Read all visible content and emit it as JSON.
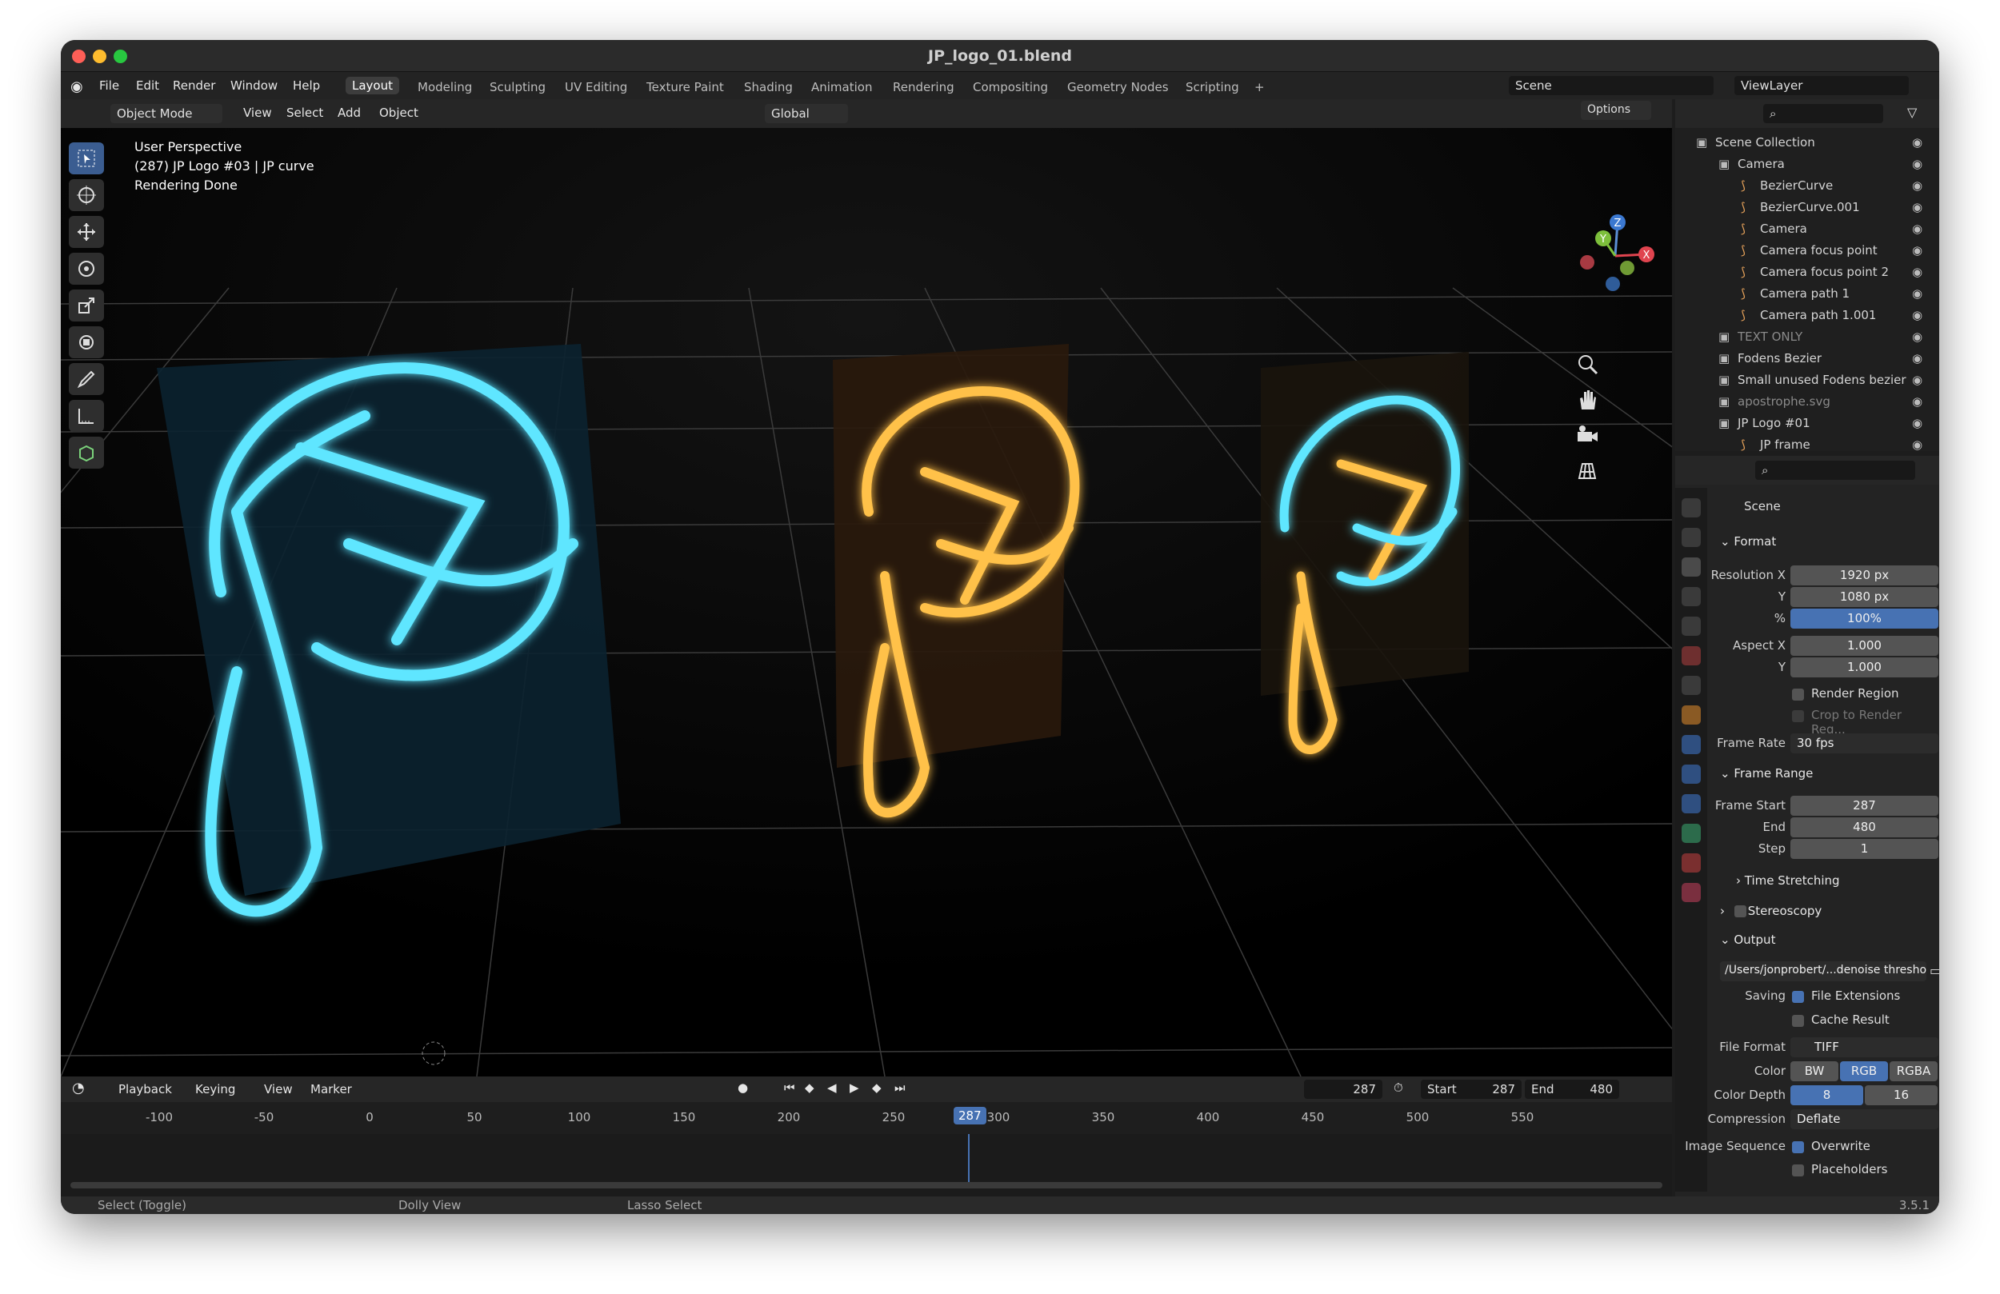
{
  "window": {
    "title": "JP_logo_01.blend"
  },
  "topbar": {
    "menus": [
      "File",
      "Edit",
      "Render",
      "Window",
      "Help"
    ],
    "workspaces": [
      "Layout",
      "Modeling",
      "Sculpting",
      "UV Editing",
      "Texture Paint",
      "Shading",
      "Animation",
      "Rendering",
      "Compositing",
      "Geometry Nodes",
      "Scripting"
    ],
    "add_tab": "+",
    "scene": "Scene",
    "view_layer": "ViewLayer"
  },
  "header3d": {
    "mode": "Object Mode",
    "menus": [
      "View",
      "Select",
      "Add",
      "Object"
    ],
    "orientation": "Global",
    "options": "Options"
  },
  "viewport": {
    "perspective": "User Perspective",
    "object_info": "(287) JP Logo #03 | JP curve",
    "status": "Rendering Done",
    "gizmo": {
      "x": "X",
      "y": "Y",
      "z": "Z"
    }
  },
  "timeline": {
    "menus": [
      "Playback",
      "Keying",
      "View",
      "Marker"
    ],
    "current_frame": "287",
    "start_label": "Start",
    "start": "287",
    "end_label": "End",
    "end": "480",
    "ticks": [
      "-100",
      "-50",
      "0",
      "50",
      "100",
      "150",
      "200",
      "250",
      "300",
      "350",
      "400",
      "450",
      "500",
      "550"
    ],
    "playhead": "287"
  },
  "statusbar": {
    "select": "Select (Toggle)",
    "dolly": "Dolly View",
    "lasso": "Lasso Select",
    "version": "3.5.1"
  },
  "outliner": {
    "rows": [
      {
        "label": "Scene Collection",
        "indent": 0
      },
      {
        "label": "Camera",
        "indent": 1
      },
      {
        "label": "BezierCurve",
        "indent": 2
      },
      {
        "label": "BezierCurve.001",
        "indent": 2
      },
      {
        "label": "Camera",
        "indent": 2
      },
      {
        "label": "Camera focus point",
        "indent": 2
      },
      {
        "label": "Camera focus point 2",
        "indent": 2
      },
      {
        "label": "Camera path 1",
        "indent": 2
      },
      {
        "label": "Camera path 1.001",
        "indent": 2
      },
      {
        "label": "TEXT ONLY",
        "indent": 1
      },
      {
        "label": "Fodens Bezier",
        "indent": 1
      },
      {
        "label": "Small unused Fodens bezier",
        "indent": 1
      },
      {
        "label": "apostrophe.svg",
        "indent": 1
      },
      {
        "label": "JP Logo #01",
        "indent": 1
      },
      {
        "label": "JP frame",
        "indent": 2
      }
    ]
  },
  "properties": {
    "context": "Scene",
    "format": {
      "title": "Format",
      "res_x_label": "Resolution X",
      "res_x": "1920 px",
      "res_y_label": "Y",
      "res_y": "1080 px",
      "pct_label": "%",
      "pct": "100%",
      "aspect_x_label": "Aspect X",
      "aspect_x": "1.000",
      "aspect_y_label": "Y",
      "aspect_y": "1.000",
      "render_region": "Render Region",
      "crop": "Crop to Render Reg...",
      "frame_rate_label": "Frame Rate",
      "frame_rate": "30 fps"
    },
    "frame_range": {
      "title": "Frame Range",
      "start_label": "Frame Start",
      "start": "287",
      "end_label": "End",
      "end": "480",
      "step_label": "Step",
      "step": "1",
      "time_stretching": "Time Stretching"
    },
    "stereoscopy": "Stereoscopy",
    "output": {
      "title": "Output",
      "path": "/Users/jonprobert/...denoise threshold/",
      "saving_label": "Saving",
      "file_extensions": "File Extensions",
      "cache_result": "Cache Result",
      "file_format_label": "File Format",
      "file_format": "TIFF",
      "color_label": "Color",
      "color_opts": [
        "BW",
        "RGB",
        "RGBA"
      ],
      "color_depth_label": "Color Depth",
      "depth_opts": [
        "8",
        "16"
      ],
      "compression_label": "Compression",
      "compression": "Deflate",
      "image_sequence_label": "Image Sequence",
      "overwrite": "Overwrite",
      "placeholders": "Placeholders"
    }
  },
  "colors": {
    "cyan": "#5fe6ff",
    "amber": "#ffc14a",
    "selected": "#4772b3"
  }
}
